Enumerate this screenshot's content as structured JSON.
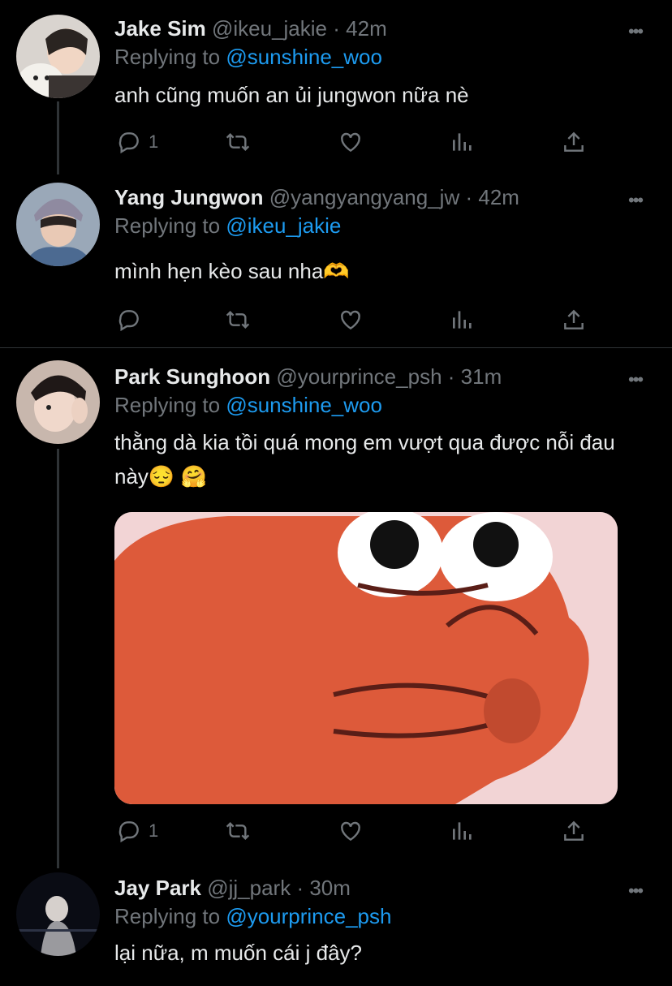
{
  "tweets": [
    {
      "name": "Jake Sim",
      "handle": "@ikeu_jakie",
      "sep": "·",
      "time": "42m",
      "reply_prefix": "Replying to",
      "reply_to": "@sunshine_woo",
      "text": "anh cũng muốn an ủi jungwon nữa nè",
      "reply_count": "1",
      "more_icon": "more-dots-icon"
    },
    {
      "name": "Yang Jungwon",
      "handle": "@yangyangyang_jw",
      "sep": "·",
      "time": "42m",
      "reply_prefix": "Replying to",
      "reply_to": "@ikeu_jakie",
      "text": "mình hẹn kèo sau nha🫶",
      "reply_count": ""
    },
    {
      "name": "Park Sunghoon",
      "handle": "@yourprince_psh",
      "sep": "·",
      "time": "31m",
      "reply_prefix": "Replying to",
      "reply_to": "@sunshine_woo",
      "text": "thằng dà kia tồi quá mong em vượt qua được nỗi đau này😔 🤗",
      "reply_count": "1"
    },
    {
      "name": "Jay Park",
      "handle": "@jj_park",
      "sep": "·",
      "time": "30m",
      "reply_prefix": "Replying to",
      "reply_to": "@yourprince_psh",
      "text": "lại nữa, m muốn cái j đây?"
    }
  ],
  "icons": [
    "reply-icon",
    "retweet-icon",
    "like-icon",
    "analytics-icon",
    "share-icon"
  ],
  "colors": {
    "background": "#000000",
    "text": "#e7e9ea",
    "muted": "#71767b",
    "link": "#1d9bf0",
    "divider": "#2f3336"
  }
}
